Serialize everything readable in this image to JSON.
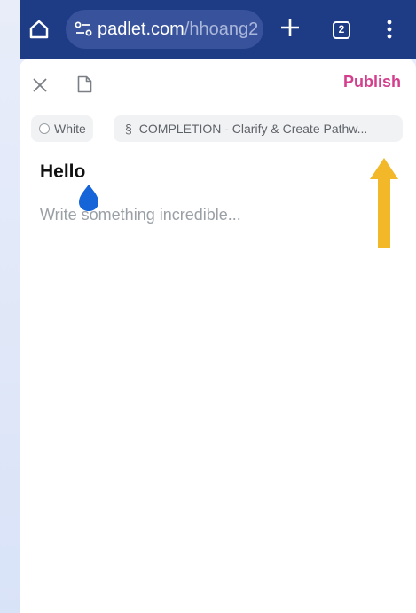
{
  "browser": {
    "url_domain": "padlet.com",
    "url_path": "/hhoang2",
    "tab_count": "2",
    "icons": [
      "home-icon",
      "site-settings-icon",
      "new-tab-plus-icon",
      "tabs-icon",
      "more-menu-icon"
    ]
  },
  "composer": {
    "publish_label": "Publish",
    "color_chip_label": "White",
    "section_chip_label": "COMPLETION - Clarify & Create Pathw...",
    "section_icon_glyph": "§",
    "post_title": "Hello",
    "post_body_placeholder": "Write something incredible...",
    "icons": [
      "close-icon",
      "attachment-doc-icon",
      "text-caret-handle-icon"
    ]
  },
  "colors": {
    "browser_bar": "#1e3b86",
    "url_pill": "#38529b",
    "publish": "#d43f8d",
    "caret": "#1565d8",
    "arrow": "#f2b829"
  }
}
